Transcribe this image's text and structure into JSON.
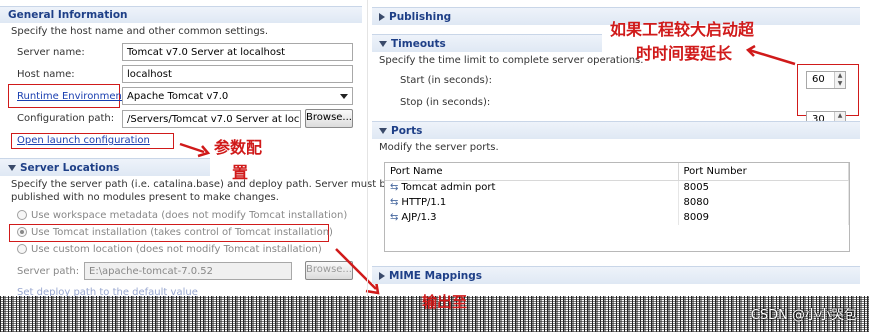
{
  "general": {
    "title": "General Information",
    "desc": "Specify the host name and other common settings.",
    "server_name_label": "Server name:",
    "server_name_value": "Tomcat v7.0 Server at localhost",
    "host_name_label": "Host name:",
    "host_name_value": "localhost",
    "runtime_label": "Runtime Environment:",
    "runtime_value": "Apache Tomcat v7.0",
    "config_label": "Configuration path:",
    "config_value": "/Servers/Tomcat v7.0 Server at localhos",
    "browse_label": "Browse...",
    "open_launch": "Open launch configuration"
  },
  "locations": {
    "title": "Server Locations",
    "desc1": "Specify the server path (i.e. catalina.base) and deploy path. Server must be",
    "desc2": "published with no modules present to make changes.",
    "opt_workspace": "Use workspace metadata (does not modify Tomcat installation)",
    "opt_tomcat": "Use Tomcat installation (takes control of Tomcat installation)",
    "opt_custom": "Use custom location (does not modify Tomcat installation)",
    "server_path_label": "Server path:",
    "server_path_value": "E:\\apache-tomcat-7.0.52",
    "browse_label": "Browse...",
    "deploy_link": "Set deploy path to the default value"
  },
  "publishing": {
    "title": "Publishing"
  },
  "timeouts": {
    "title": "Timeouts",
    "desc": "Specify the time limit to complete server operations.",
    "start_label": "Start (in seconds):",
    "start_value": "60",
    "stop_label": "Stop (in seconds):",
    "stop_value": "30"
  },
  "ports": {
    "title": "Ports",
    "desc": "Modify the server ports.",
    "columns": [
      "Port Name",
      "Port Number"
    ],
    "rows": [
      {
        "name": "Tomcat admin port",
        "number": "8005"
      },
      {
        "name": "HTTP/1.1",
        "number": "8080"
      },
      {
        "name": "AJP/1.3",
        "number": "8009"
      }
    ]
  },
  "mime": {
    "title": "MIME Mappings"
  },
  "annotations": {
    "params_1": "参数配",
    "params_2": "置",
    "timeout_1": "如果工程较大启动超",
    "timeout_2": "时时间要延长",
    "output_partial": "输出至"
  },
  "watermark": "CSDN @小小哭包",
  "colors": {
    "section_title": "#1e3f87",
    "link": "#1a3fb0",
    "annotation_red": "#d01a1a"
  }
}
